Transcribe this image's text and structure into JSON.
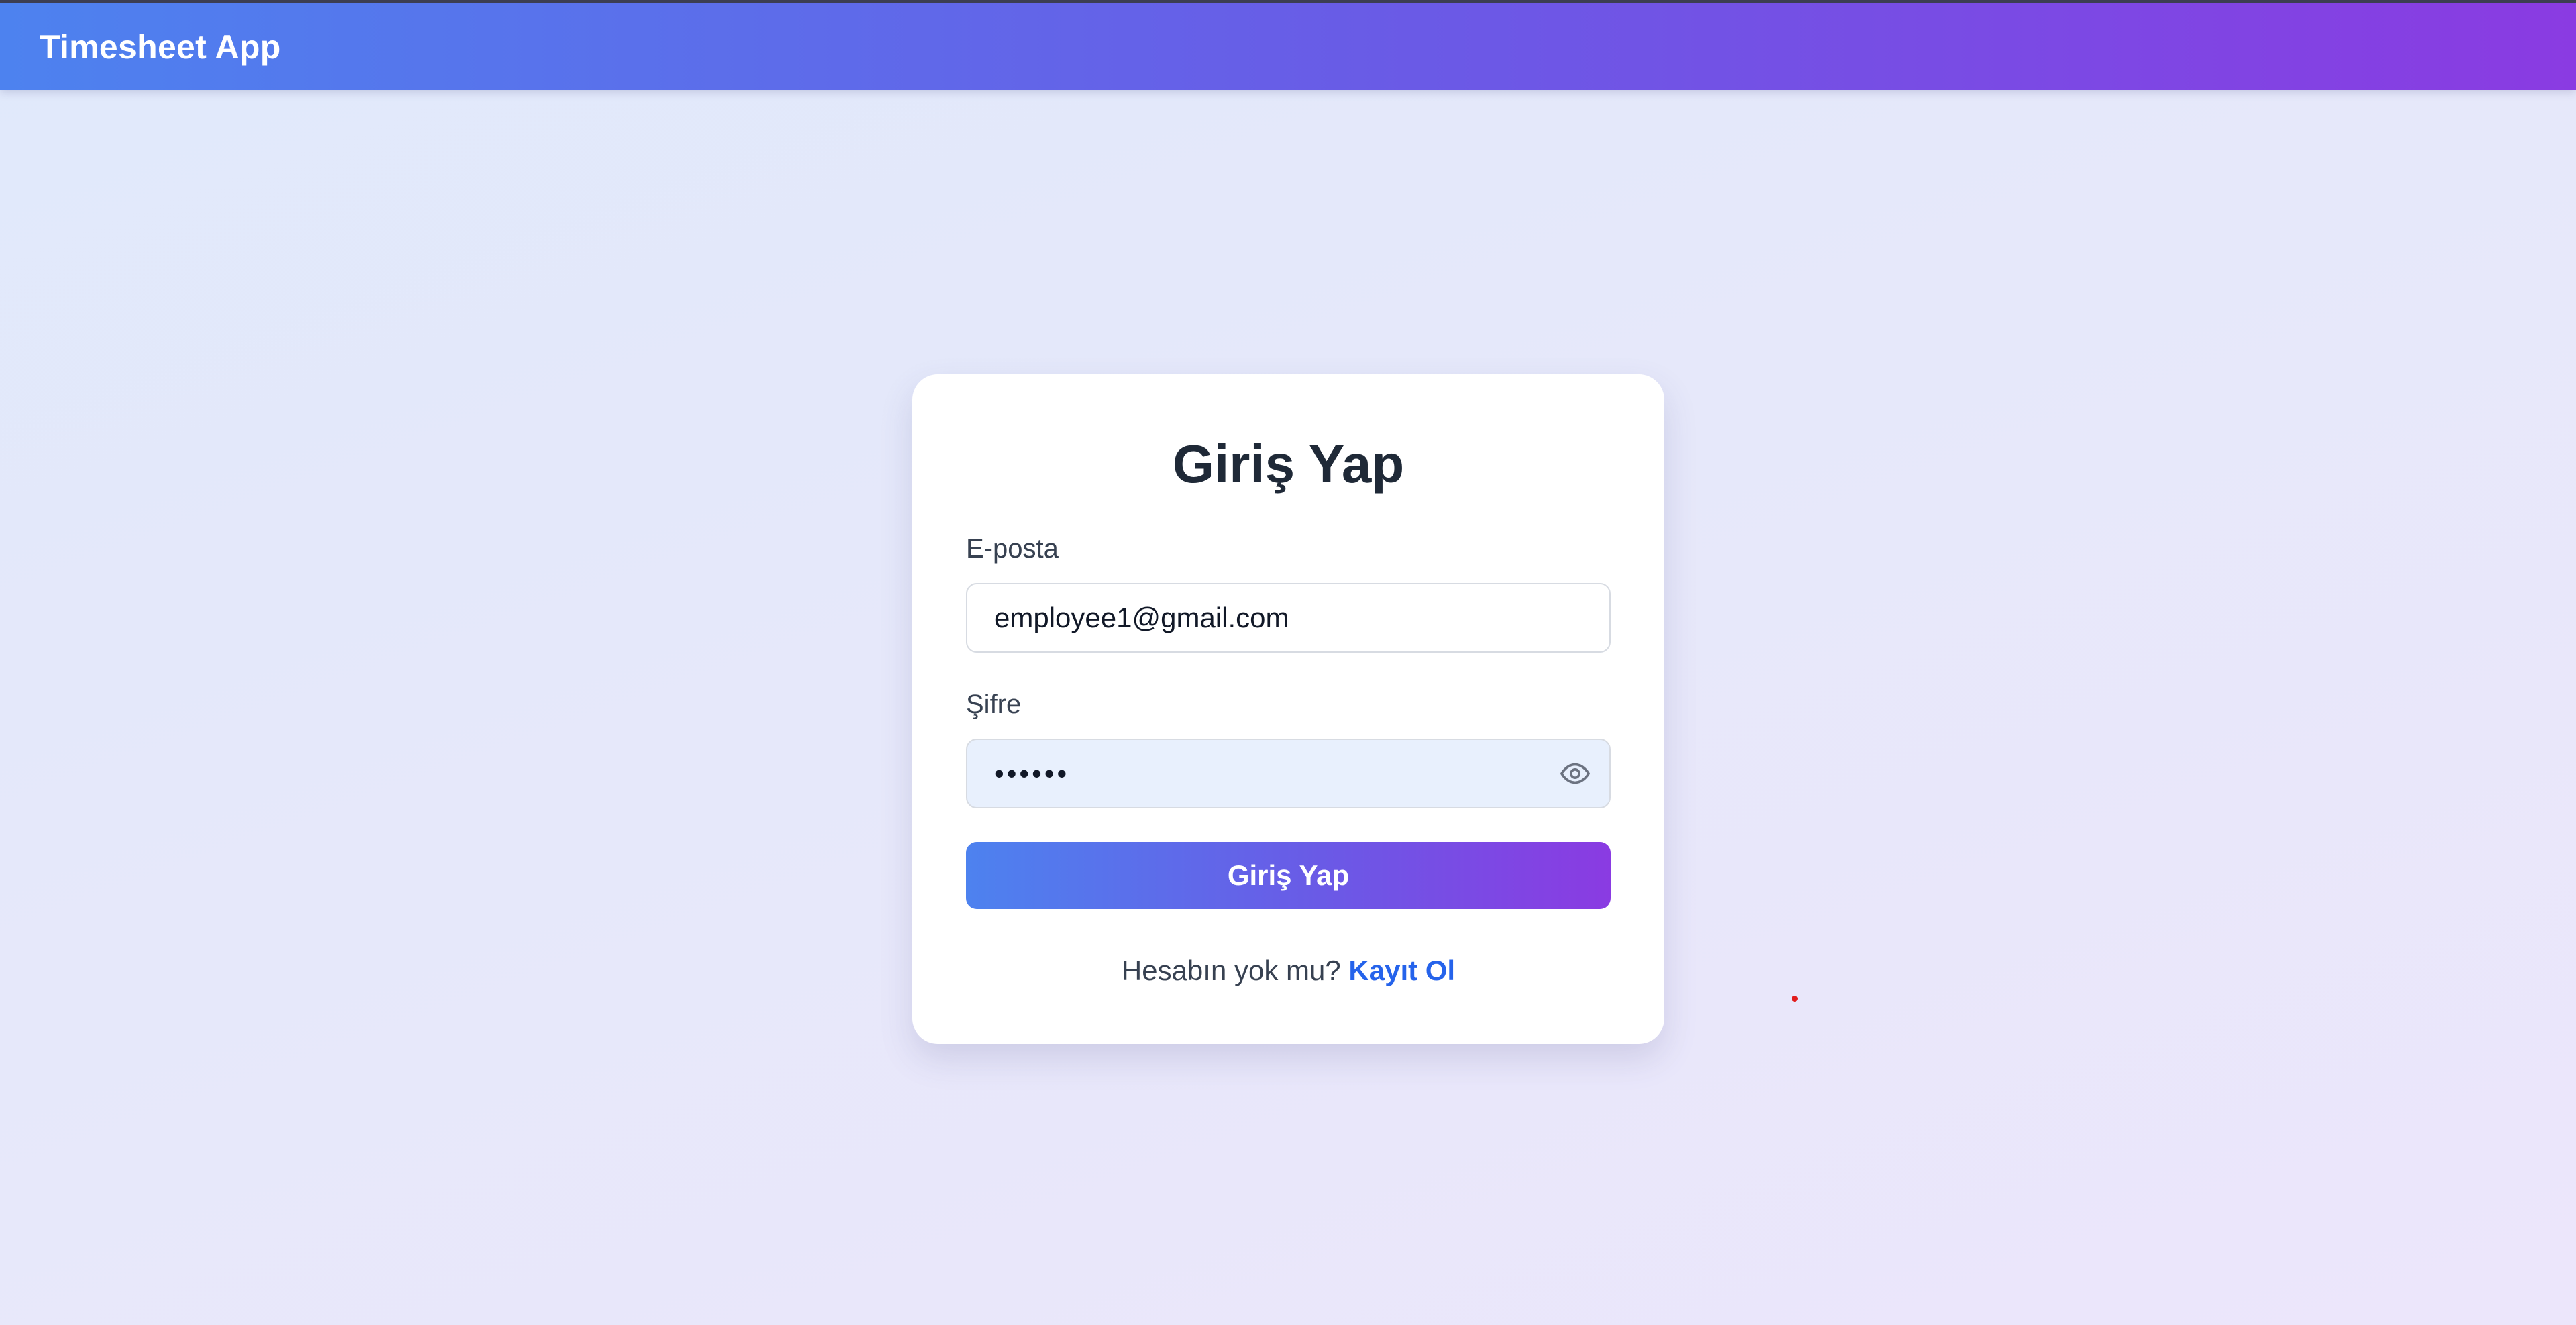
{
  "navbar": {
    "brand": "Timesheet App"
  },
  "login_form": {
    "title": "Giriş Yap",
    "email": {
      "label": "E-posta",
      "value": "employee1@gmail.com",
      "type": "email"
    },
    "password": {
      "label": "Şifre",
      "value": "••••••",
      "masked": true,
      "toggle_icon": "eye-icon"
    },
    "submit_label": "Giriş Yap",
    "signup_prompt": "Hesabın yok mu?",
    "signup_link": "Kayıt Ol"
  },
  "colors": {
    "brand_gradient_start": "#4d82ef",
    "brand_gradient_end": "#8a3be2",
    "link": "#2563eb",
    "title": "#1f2937",
    "password_field_bg": "#e8f0fd"
  }
}
